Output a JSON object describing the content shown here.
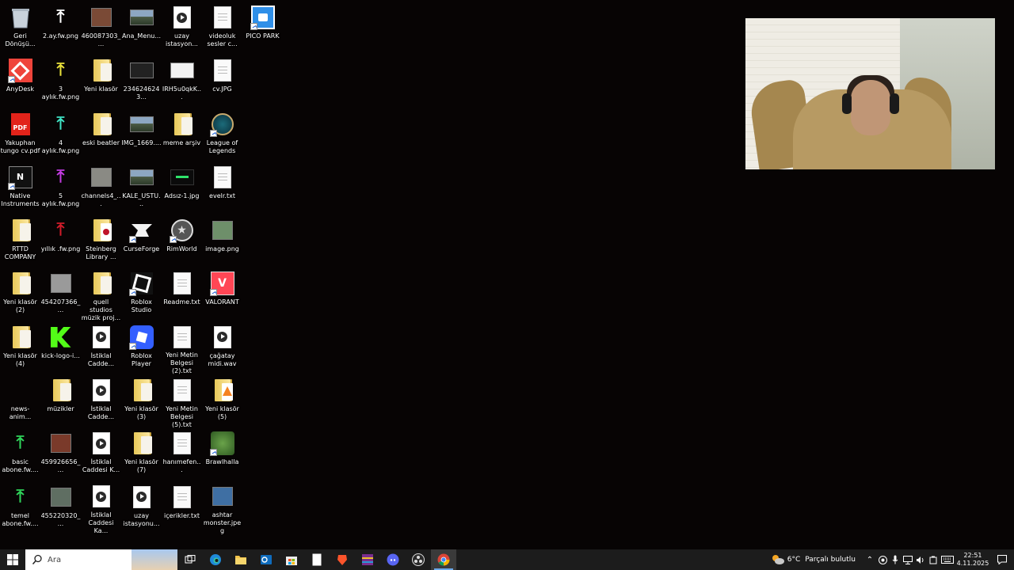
{
  "desktop": {
    "icons": [
      {
        "label": "Geri Dönüşü...",
        "type": "recycle"
      },
      {
        "label": "2.ay.fw.png",
        "type": "arrow",
        "color": "#ffffff"
      },
      {
        "label": "460087303_...",
        "type": "photo",
        "color": "#7a4a36"
      },
      {
        "label": "Ana_Menu...",
        "type": "landscape"
      },
      {
        "label": "uzay istasyon...",
        "type": "media"
      },
      {
        "label": "videoluk sesler c...",
        "type": "doc"
      },
      {
        "label": "PICO PARK",
        "type": "pico"
      },
      {
        "label": "AnyDesk",
        "type": "anydesk"
      },
      {
        "label": "3 aylık.fw.png",
        "type": "arrow",
        "color": "#e8e03a"
      },
      {
        "label": "Yeni klasör",
        "type": "folder"
      },
      {
        "label": "2346246243...",
        "type": "dark"
      },
      {
        "label": "IRH5u0qkK...",
        "type": "white"
      },
      {
        "label": "cv.JPG",
        "type": "doc"
      },
      {
        "label": "",
        "type": "empty"
      },
      {
        "label": "Yakuphan tungo cv.pdf",
        "type": "pdf"
      },
      {
        "label": "4 aylık.fw.png",
        "type": "arrow",
        "color": "#3fe2c4"
      },
      {
        "label": "eski beatler",
        "type": "folder"
      },
      {
        "label": "IMG_1669....",
        "type": "landscape"
      },
      {
        "label": "meme arşiv",
        "type": "folder"
      },
      {
        "label": "League of Legends",
        "type": "lol"
      },
      {
        "label": "",
        "type": "empty"
      },
      {
        "label": "Native Instruments",
        "type": "ni"
      },
      {
        "label": "5 aylık.fw.png",
        "type": "arrow",
        "color": "#c23be0"
      },
      {
        "label": "channels4_...",
        "type": "photo",
        "color": "#8a8a84"
      },
      {
        "label": "KALE_USTU...",
        "type": "landscape"
      },
      {
        "label": "Adsız-1.jpg",
        "type": "green"
      },
      {
        "label": "evelr.txt",
        "type": "doc"
      },
      {
        "label": "",
        "type": "empty"
      },
      {
        "label": "RTTD COMPANY",
        "type": "folder"
      },
      {
        "label": "yıllık .fw.png",
        "type": "arrow",
        "color": "#d11c2a"
      },
      {
        "label": "Steinberg Library ...",
        "type": "steinberg"
      },
      {
        "label": "CurseForge",
        "type": "curse"
      },
      {
        "label": "RimWorld",
        "type": "rim"
      },
      {
        "label": "image.png",
        "type": "photo",
        "color": "#6e8f6a"
      },
      {
        "label": "",
        "type": "empty"
      },
      {
        "label": "Yeni klasör (2)",
        "type": "folder"
      },
      {
        "label": "454207366_...",
        "type": "photo",
        "color": "#9a9a9a"
      },
      {
        "label": "quell studios müzik proj...",
        "type": "folder"
      },
      {
        "label": "Roblox Studio",
        "type": "roblox"
      },
      {
        "label": "Readme.txt",
        "type": "doc"
      },
      {
        "label": "VALORANT",
        "type": "valorant"
      },
      {
        "label": "",
        "type": "empty"
      },
      {
        "label": "Yeni klasör (4)",
        "type": "folder"
      },
      {
        "label": "kick-logo-i...",
        "type": "kick"
      },
      {
        "label": "İstiklal Cadde...",
        "type": "media"
      },
      {
        "label": "Roblox Player",
        "type": "robloxplayer"
      },
      {
        "label": "Yeni Metin Belgesi (2).txt",
        "type": "doc"
      },
      {
        "label": "çağatay midi.wav",
        "type": "media"
      },
      {
        "label": "",
        "type": "empty"
      },
      {
        "label": "news-anim...",
        "type": "none"
      },
      {
        "label": "müzikler",
        "type": "folder"
      },
      {
        "label": "İstiklal Cadde...",
        "type": "media"
      },
      {
        "label": "Yeni klasör (3)",
        "type": "folder"
      },
      {
        "label": "Yeni Metin Belgesi (5).txt",
        "type": "doc"
      },
      {
        "label": "Yeni klasör (5)",
        "type": "vlc"
      },
      {
        "label": "",
        "type": "empty"
      },
      {
        "label": "basic abone.fw....",
        "type": "arrow",
        "color": "#2fd35a"
      },
      {
        "label": "459926656_...",
        "type": "photo",
        "color": "#7a3a2a"
      },
      {
        "label": "İstiklal Caddesi K...",
        "type": "media"
      },
      {
        "label": "Yeni klasör (7)",
        "type": "folder"
      },
      {
        "label": "hanımefen...",
        "type": "doc"
      },
      {
        "label": "Brawlhalla",
        "type": "brawl"
      },
      {
        "label": "",
        "type": "empty"
      },
      {
        "label": "temel abone.fw....",
        "type": "arrow",
        "color": "#2fd35a"
      },
      {
        "label": "455220320_...",
        "type": "photo",
        "color": "#5f6e62"
      },
      {
        "label": "İstiklal Caddesi Ka...",
        "type": "media"
      },
      {
        "label": "uzay istasyonu...",
        "type": "media"
      },
      {
        "label": "içerikler.txt",
        "type": "doc"
      },
      {
        "label": "ashtar monster.jpeg",
        "type": "photo",
        "color": "#3f6fa3"
      },
      {
        "label": "",
        "type": "empty"
      }
    ]
  },
  "taskbar": {
    "search_placeholder": "Ara",
    "apps": [
      "task-view",
      "edge",
      "file-explorer",
      "outlook",
      "microsoft-store",
      "notepad",
      "brave",
      "winrar",
      "discord",
      "obs",
      "chrome"
    ],
    "weather_temp": "6°C",
    "weather_text": "Parçalı bulutlu",
    "time": "22:51",
    "date": "4.11.2025"
  },
  "colors": {
    "desktop_bg": "#070404",
    "taskbar_bg": "#1c1c1c",
    "accent": "#6aa8e8"
  }
}
